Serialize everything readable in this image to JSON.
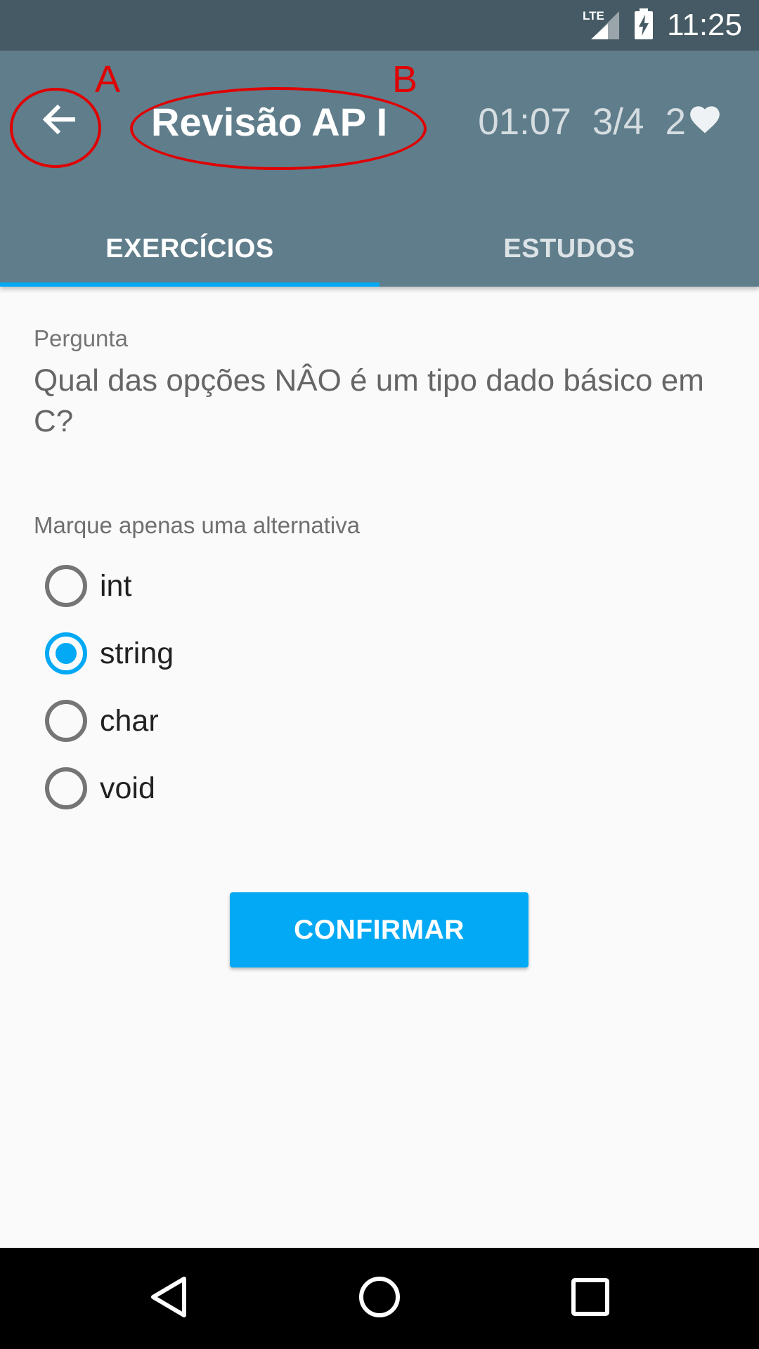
{
  "status_bar": {
    "time": "11:25",
    "network": "LTE"
  },
  "toolbar": {
    "title": "Revisão AP I",
    "timer": "01:07",
    "progress": "3/4",
    "lives": "2",
    "icons": {
      "back": "arrow-back-icon",
      "lives": "heart-icon"
    }
  },
  "annotations": {
    "a": "A",
    "b": "B"
  },
  "tabs": [
    {
      "label": "EXERCÍCIOS",
      "active": true
    },
    {
      "label": "ESTUDOS",
      "active": false
    }
  ],
  "question": {
    "label": "Pergunta",
    "text": "Qual das opções NÂO é um tipo dado básico em C?"
  },
  "answers": {
    "instruction": "Marque apenas uma alternativa",
    "options": [
      {
        "label": "int",
        "selected": false
      },
      {
        "label": "string",
        "selected": true
      },
      {
        "label": "char",
        "selected": false
      },
      {
        "label": "void",
        "selected": false
      }
    ]
  },
  "confirm_label": "CONFIRMAR",
  "colors": {
    "status_bar": "#455a64",
    "toolbar": "#607d8b",
    "accent": "#03a9f4",
    "annotation": "#e00000"
  }
}
